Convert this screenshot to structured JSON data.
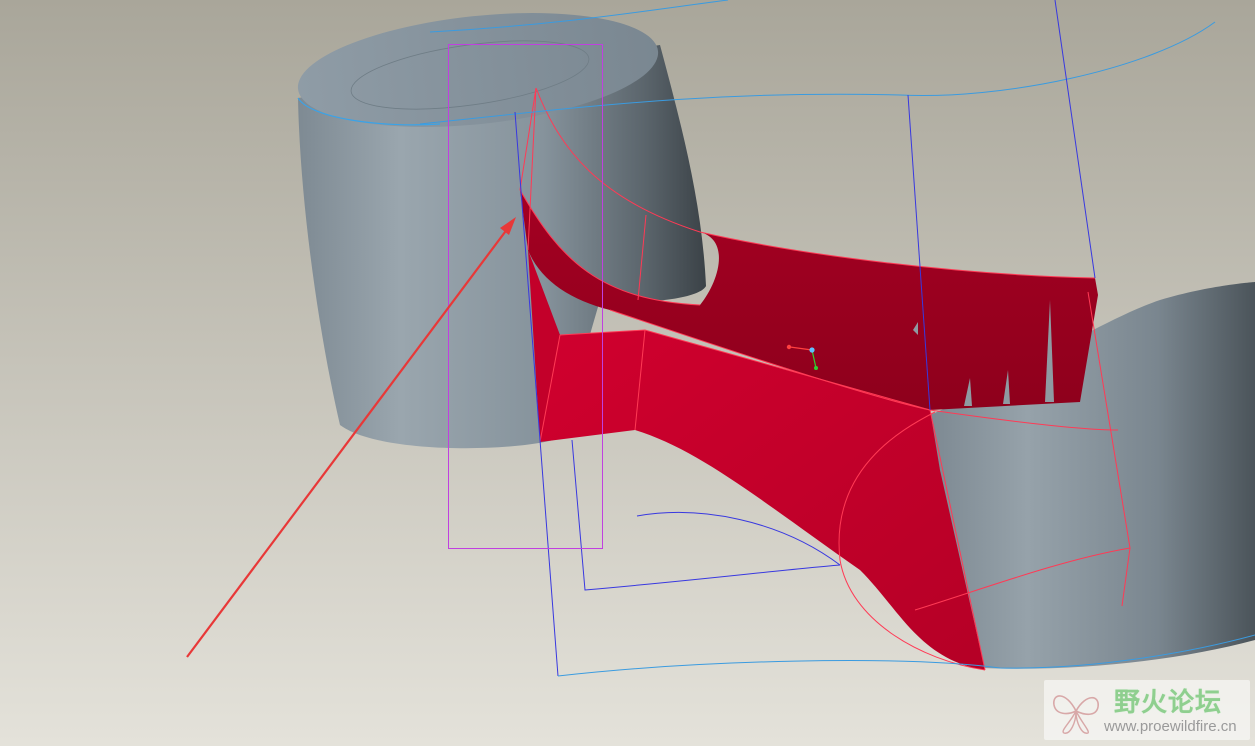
{
  "watermark": {
    "title": "野火论坛",
    "url": "www.proewildfire.cn",
    "logo_icon": "butterfly-logo-icon"
  },
  "colors": {
    "background_top": "#a9a69a",
    "background_bottom": "#e3e1d9",
    "surface": "#8a98a2",
    "surface_dark": "#3e464c",
    "selected_surface": "#c1002a",
    "selected_edge": "#ff3050",
    "datum_curve": "#3838e0",
    "sketch_curve": "#3a9be0",
    "bounding_box": "#c040e0",
    "annotation_arrow": "#e83838"
  }
}
